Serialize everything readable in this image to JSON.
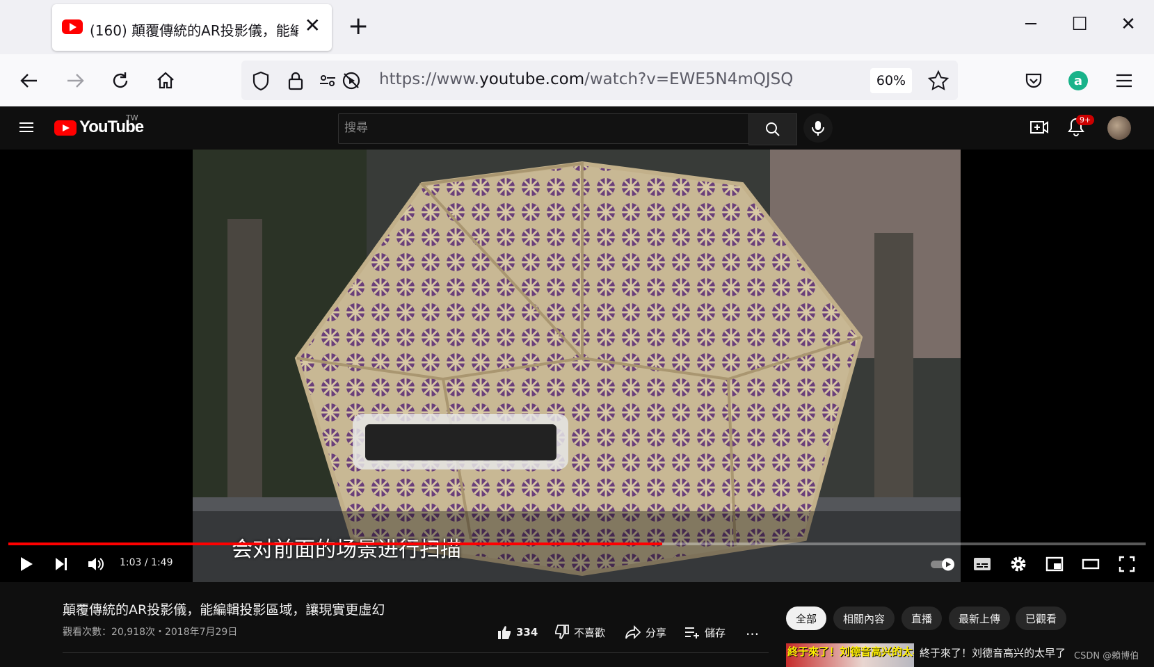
{
  "browser": {
    "tab_title": "(160) 顛覆傳統的AR投影儀，能編",
    "tab_close": "✕",
    "new_tab": "+",
    "url_prefix": "https://www.",
    "url_host": "youtube.com",
    "url_path": "/watch?v=EWE5N4mQJSQ",
    "zoom": "60%"
  },
  "youtube": {
    "logo_text": "YouTube",
    "region": "TW",
    "search_placeholder": "搜尋",
    "notification_badge": "9+"
  },
  "player": {
    "subtitle": "会对前面的场景进行扫描",
    "time_display": "1:03 / 1:49",
    "progress_fraction": 0.575
  },
  "video": {
    "title": "顛覆傳統的AR投影儀，能編輯投影區域，讓現實更虛幻",
    "meta": "觀看次數：20,918次・2018年7月29日",
    "likes": "334",
    "dislike_label": "不喜歡",
    "share_label": "分享",
    "save_label": "儲存",
    "more": "..."
  },
  "chips": [
    "全部",
    "相關內容",
    "直播",
    "最新上傳",
    "已觀看"
  ],
  "related": {
    "thumb_text": "終于來了！刘德音高兴的太早了太早了",
    "title": "終于來了！刘德音高兴的太早了"
  },
  "watermark": "CSDN @賴博伯"
}
